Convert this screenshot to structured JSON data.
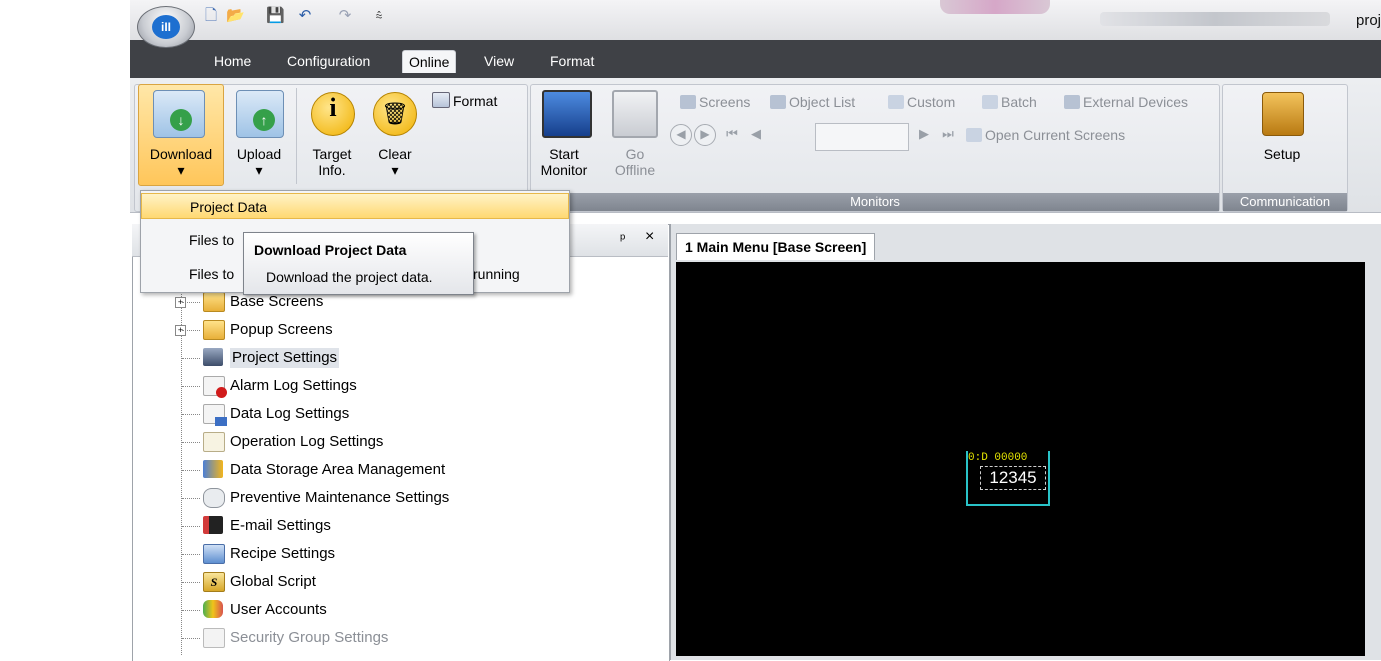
{
  "title_right": "proj",
  "quick_access": [
    "new-icon",
    "open-icon",
    "save-icon",
    "undo-icon",
    "redo-icon",
    "customize-qat-icon"
  ],
  "tabs": [
    "Home",
    "Configuration",
    "Online",
    "View",
    "Format"
  ],
  "active_tab": "Online",
  "ribbon": {
    "download": {
      "line1": "Download",
      "line2": "▾"
    },
    "upload": {
      "line1": "Upload",
      "line2": "▾"
    },
    "target_info": {
      "line1": "Target",
      "line2": "Info."
    },
    "clear": {
      "line1": "Clear",
      "line2": "▾"
    },
    "format": "Format",
    "start_monitor": {
      "line1": "Start",
      "line2": "Monitor"
    },
    "go_offline": {
      "line1": "Go",
      "line2": "Offline"
    },
    "screens": "Screens",
    "object_list": "Object List",
    "custom": "Custom",
    "batch": "Batch",
    "external_devices": "External Devices",
    "open_current_screens": "Open Current Screens",
    "monitors_label": "Monitors",
    "setup": "Setup",
    "communication_label": "Communication"
  },
  "download_menu": {
    "items": [
      "Project Data",
      "Files to",
      "Files to"
    ],
    "item3_tail": "running"
  },
  "tooltip": {
    "title": "Download Project Data",
    "text": "Download the project data."
  },
  "panel": {
    "pin": "ᵖ",
    "close": "×"
  },
  "tree": [
    "Base Screens",
    "Popup Screens",
    "Project Settings",
    "Alarm Log Settings",
    "Data Log Settings",
    "Operation Log Settings",
    "Data Storage Area Management",
    "Preventive Maintenance Settings",
    "E-mail Settings",
    "Recipe Settings",
    "Global Script",
    "User Accounts",
    "Security Group Settings"
  ],
  "document_tab": "1 Main Menu [Base Screen]",
  "screen_object": {
    "address": "0:D 00000",
    "value": "12345"
  }
}
